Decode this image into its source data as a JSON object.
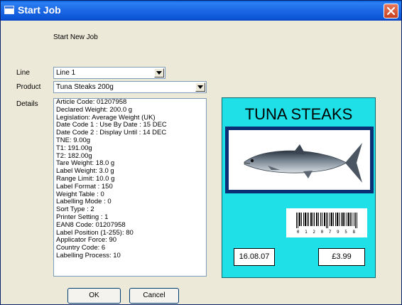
{
  "window": {
    "title": "Start Job"
  },
  "heading": "Start New Job",
  "form": {
    "line_label": "Line",
    "line_value": "Line 1",
    "product_label": "Product",
    "product_value": "Tuna Steaks 200g",
    "details_label": "Details"
  },
  "details": [
    "Article Code: 01207958",
    "Declared Weight: 200.0 g",
    "Legislation: Average Weight (UK)",
    "Date Code 1 : Use By Date : 15 DEC",
    "Date Code 2 : Display Until : 14 DEC",
    "TNE: 9.00g",
    "T1: 191.00g",
    "T2: 182.00g",
    "Tare Weight:  18.0 g",
    "Label Weight:   3.0 g",
    "Range Limit:  10.0 g",
    "Label Format : 150",
    "Weight Table : 0",
    "Labelling Mode : 0",
    "Sort Type : 2",
    "Printer Setting : 1",
    "EAN8 Code: 01207958",
    "Label Position (1-255): 80",
    "Applicator Force: 90",
    "Country Code: 6",
    "Labelling Process: 10"
  ],
  "label_preview": {
    "title": "TUNA STEAKS",
    "barcode_number": "0 1 2 0 7 9 5 8",
    "date": "16.08.07",
    "price": "£3.99",
    "background_color": "#1ee0e6"
  },
  "buttons": {
    "ok": "OK",
    "cancel": "Cancel"
  },
  "icons": {
    "window": "window-icon",
    "close": "close-icon",
    "dropdown": "chevron-down-icon",
    "fish": "fish-icon"
  }
}
